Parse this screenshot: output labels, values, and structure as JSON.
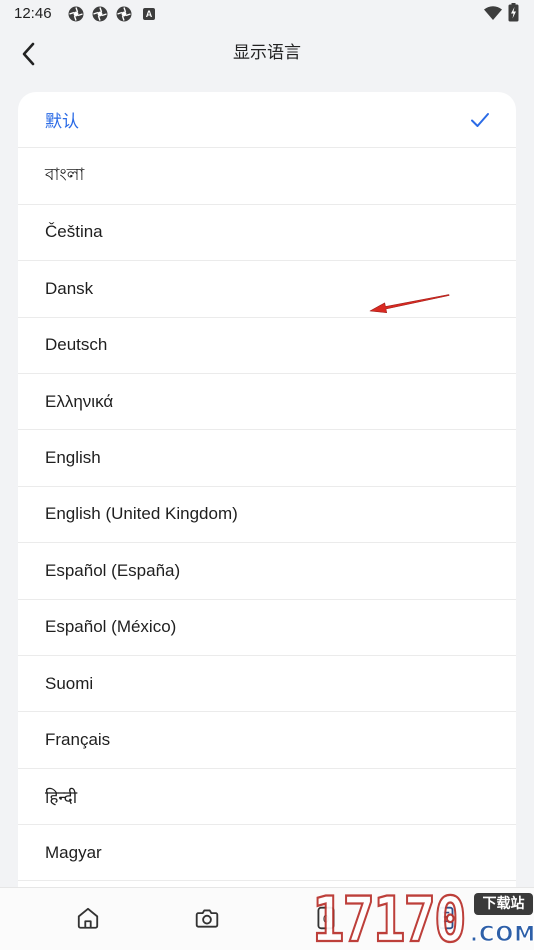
{
  "status_bar": {
    "time": "12:46",
    "notification_icons": [
      "aperture-icon",
      "aperture-icon",
      "aperture-icon"
    ],
    "badge_letter": "A",
    "system_icons": [
      "wifi-icon",
      "battery-charging-icon"
    ]
  },
  "header": {
    "back_icon": "chevron-left-icon",
    "title": "显示语言"
  },
  "language_list": {
    "selected_icon": "checkmark-icon",
    "items": [
      {
        "label": "默认",
        "selected": true
      },
      {
        "label": "বাংলা",
        "selected": false
      },
      {
        "label": "Čeština",
        "selected": false
      },
      {
        "label": "Dansk",
        "selected": false
      },
      {
        "label": "Deutsch",
        "selected": false
      },
      {
        "label": "Ελληνικά",
        "selected": false
      },
      {
        "label": "English",
        "selected": false
      },
      {
        "label": "English (United Kingdom)",
        "selected": false
      },
      {
        "label": "Español (España)",
        "selected": false
      },
      {
        "label": "Español (México)",
        "selected": false
      },
      {
        "label": "Suomi",
        "selected": false
      },
      {
        "label": "Français",
        "selected": false
      },
      {
        "label": "हिन्दी",
        "selected": false
      },
      {
        "label": "Magyar",
        "selected": false
      }
    ]
  },
  "bottom_nav": {
    "items": [
      {
        "icon": "home-icon"
      },
      {
        "icon": "camera-icon"
      },
      {
        "icon": "counter-icon",
        "badge": "0"
      },
      {
        "icon": "device-grid-icon"
      }
    ]
  },
  "watermark": {
    "number": "17170",
    "tag": "下载站",
    "domain": ".COM"
  },
  "colors": {
    "accent": "#2b6be6",
    "text": "#1f1f1f",
    "background": "#f2f3f5",
    "surface": "#ffffff",
    "divider": "#ebebeb",
    "annotation": "#d92a22"
  }
}
